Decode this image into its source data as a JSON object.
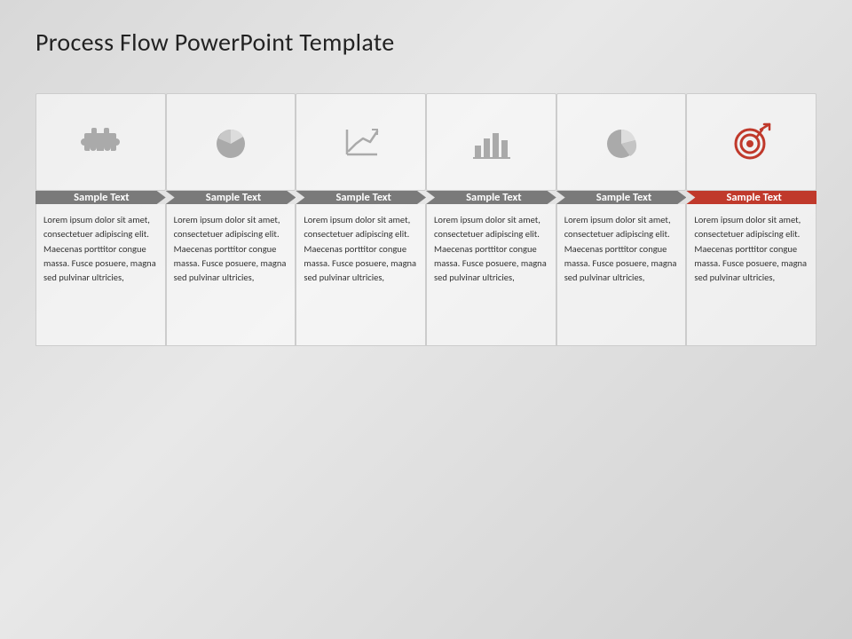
{
  "slide": {
    "title": "Process Flow PowerPoint Template",
    "steps": [
      {
        "id": 1,
        "icon": "puzzle",
        "label": "Sample Text",
        "isFirst": true,
        "isOrange": false,
        "description": "Lorem ipsum dolor sit amet, consectetuer adipiscing elit. Maecenas porttitor congue massa. Fusce posuere, magna sed pulvinar ultricies,"
      },
      {
        "id": 2,
        "icon": "pie",
        "label": "Sample Text",
        "isFirst": false,
        "isOrange": false,
        "description": "Lorem ipsum dolor sit amet, consectetuer adipiscing elit. Maecenas porttitor congue massa. Fusce posuere, magna sed pulvinar ultricies,"
      },
      {
        "id": 3,
        "icon": "line-chart",
        "label": "Sample Text",
        "isFirst": false,
        "isOrange": false,
        "description": "Lorem ipsum dolor sit amet, consectetuer adipiscing elit. Maecenas porttitor congue massa. Fusce posuere, magna sed pulvinar ultricies,"
      },
      {
        "id": 4,
        "icon": "bar-chart",
        "label": "Sample Text",
        "isFirst": false,
        "isOrange": false,
        "description": "Lorem ipsum dolor sit amet, consectetuer adipiscing elit. Maecenas porttitor congue massa. Fusce posuere, magna sed pulvinar ultricies,"
      },
      {
        "id": 5,
        "icon": "pie2",
        "label": "Sample Text",
        "isFirst": false,
        "isOrange": false,
        "description": "Lorem ipsum dolor sit amet, consectetuer adipiscing elit. Maecenas porttitor congue massa. Fusce posuere, magna sed pulvinar ultricies,"
      },
      {
        "id": 6,
        "icon": "target",
        "label": "Sample Text",
        "isFirst": false,
        "isOrange": true,
        "description": "Lorem ipsum dolor sit amet, consectetuer adipiscing elit. Maecenas porttitor congue massa. Fusce posuere, magna sed pulvinar ultricies,"
      }
    ]
  }
}
